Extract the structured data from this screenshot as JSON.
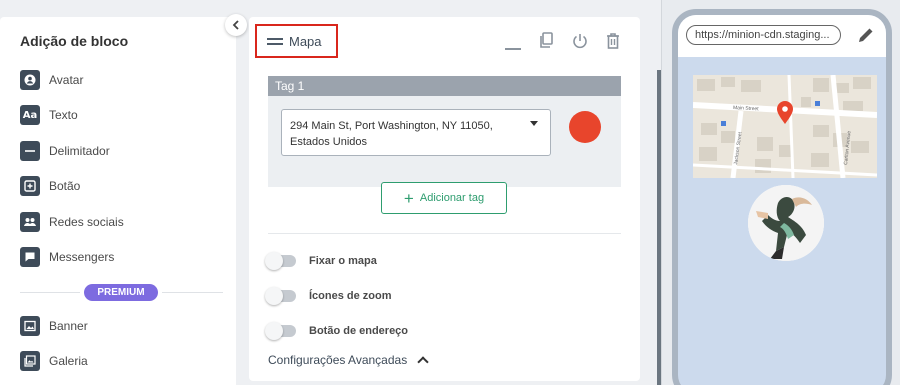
{
  "sidebar": {
    "title": "Adição de bloco",
    "items": [
      {
        "label": "Avatar",
        "icon": "avatar-icon",
        "glyph": "●"
      },
      {
        "label": "Texto",
        "icon": "text-icon",
        "glyph": "Aa"
      },
      {
        "label": "Delimitador",
        "icon": "divider-icon",
        "glyph": "—"
      },
      {
        "label": "Botão",
        "icon": "button-icon",
        "glyph": "+"
      },
      {
        "label": "Redes sociais",
        "icon": "social-icon",
        "glyph": "••"
      },
      {
        "label": "Messengers",
        "icon": "chat-icon",
        "glyph": "▪"
      }
    ],
    "premium_label": "PREMIUM",
    "premium_items": [
      {
        "label": "Banner",
        "icon": "banner-icon",
        "glyph": "▣"
      },
      {
        "label": "Galeria",
        "icon": "gallery-icon",
        "glyph": "▤"
      }
    ]
  },
  "editor": {
    "title": "Mapa",
    "tag": {
      "header": "Tag 1",
      "address": "294 Main St, Port Washington, NY 11050, Estados Unidos",
      "color": "#e8452c"
    },
    "add_tag_label": "Adicionar tag",
    "toggles": [
      {
        "label": "Fixar o mapa",
        "on": false
      },
      {
        "label": "Ícones de zoom",
        "on": false
      },
      {
        "label": "Botão de endereço",
        "on": false
      }
    ],
    "advanced_label": "Configurações Avançadas"
  },
  "preview": {
    "url": "https://minion-cdn.staging...",
    "map_street_labels": [
      "Main Street",
      "Jackson Street",
      "Carlton Avenue"
    ]
  },
  "colors": {
    "accent_green": "#2e9d6f",
    "premium_purple": "#7d6be0",
    "highlight_red": "#d9261c",
    "phone_bg": "#ccdaed"
  }
}
